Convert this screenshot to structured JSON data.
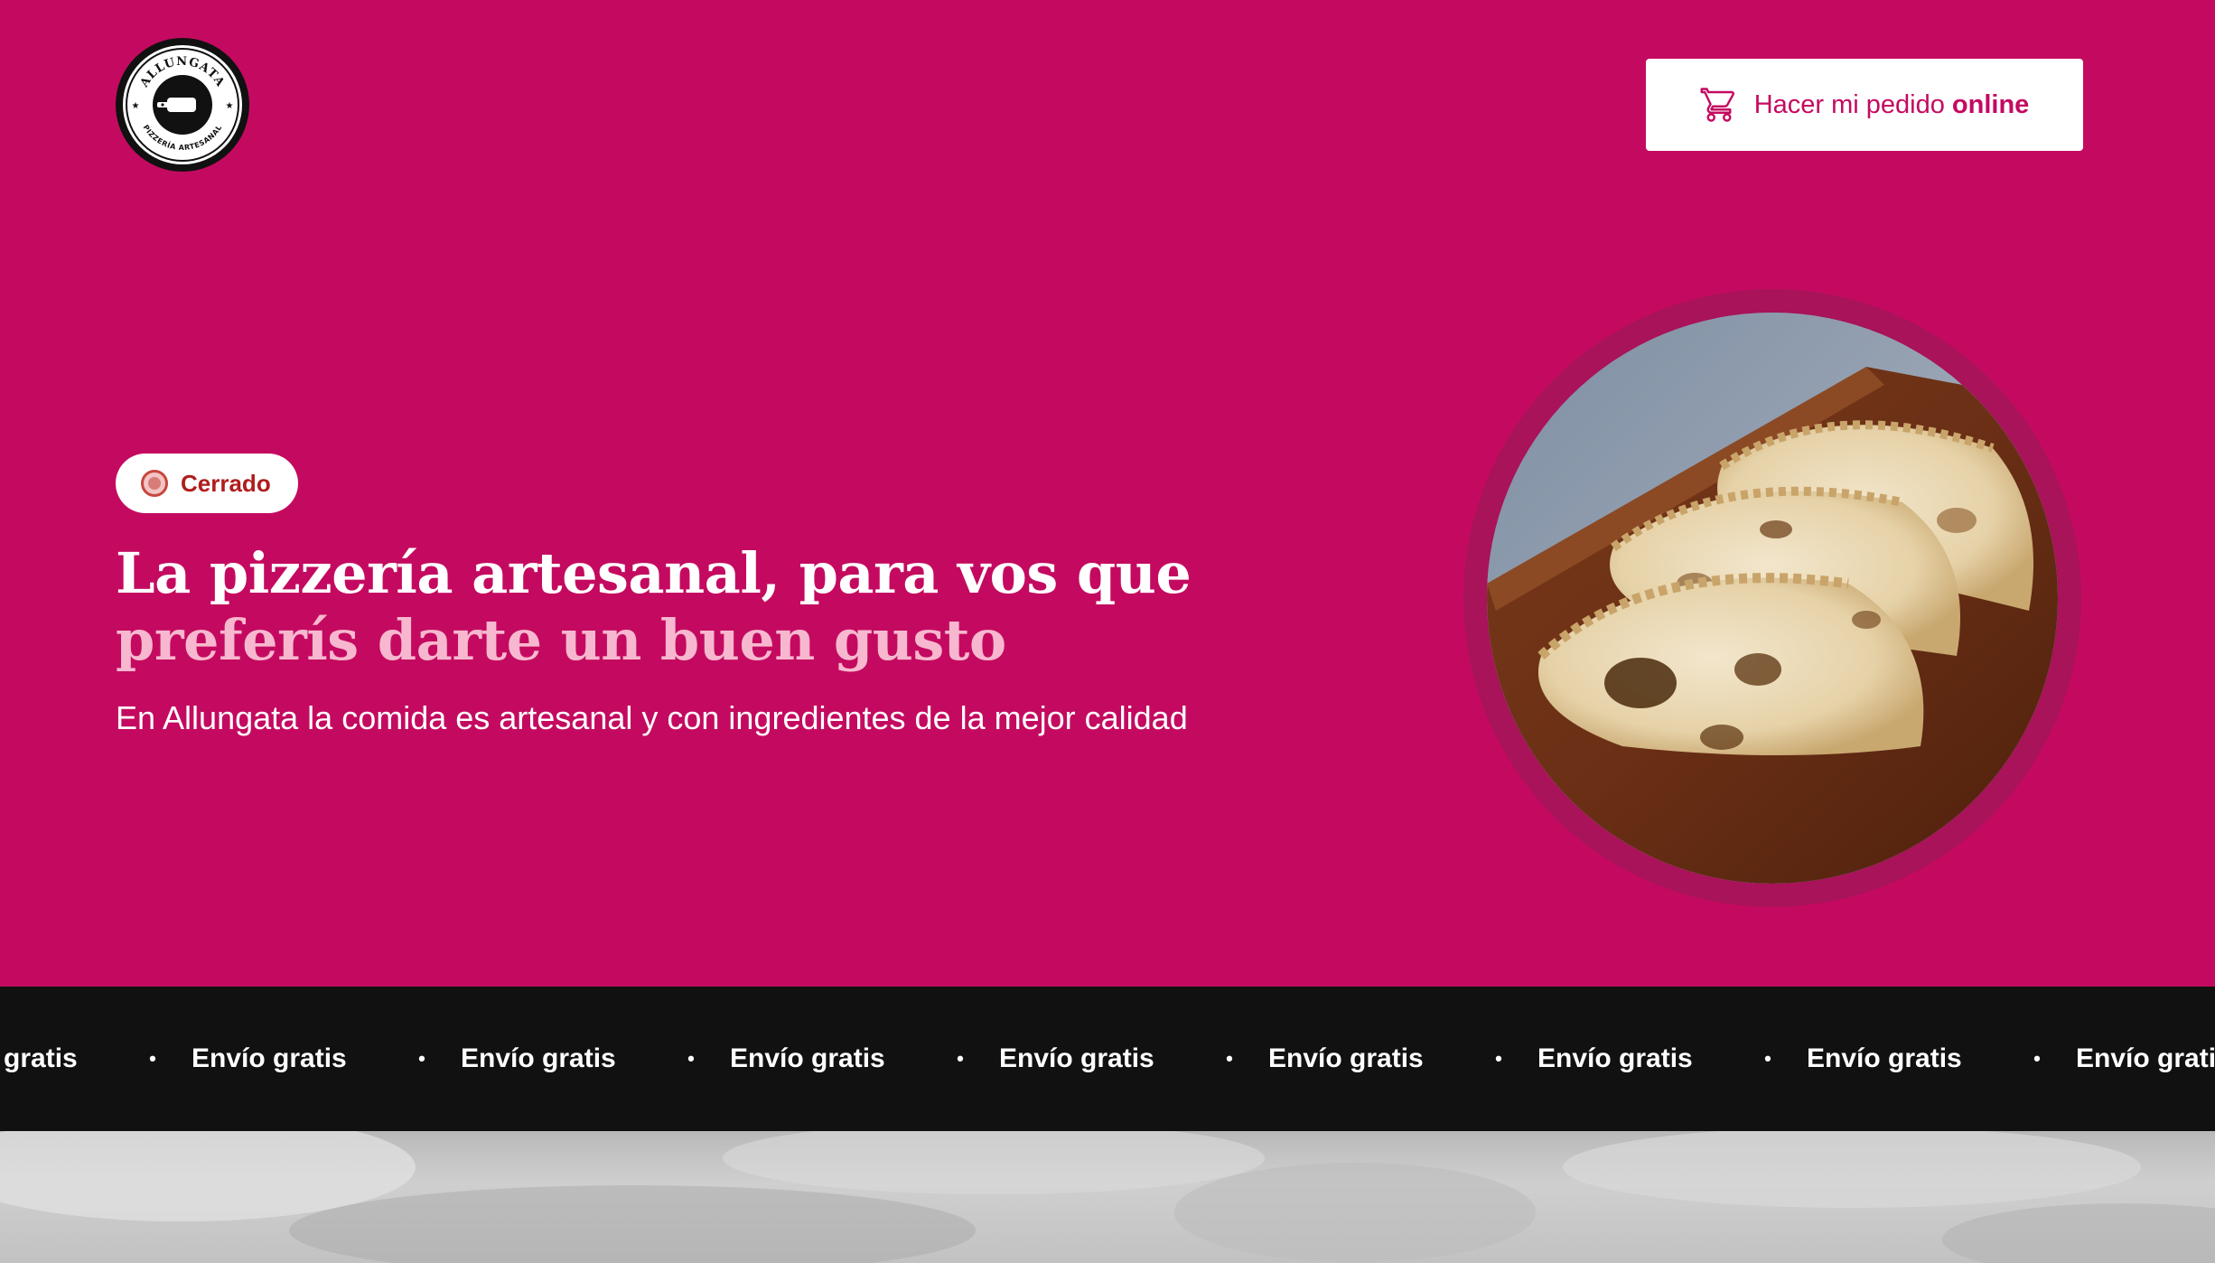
{
  "brand": {
    "logo_top_text": "ALLUNGATA",
    "logo_bottom_text": "PIZZERÍA ARTESANAL",
    "primary_color": "#c40a60",
    "accent_text_color": "#f7b8cf"
  },
  "header": {
    "order_button": {
      "label_prefix": "Hacer mi pedido",
      "label_bold": "online",
      "icon": "cart-icon"
    }
  },
  "hero": {
    "status": {
      "label": "Cerrado",
      "color": "#b01d1d"
    },
    "headline_main": "La pizzería artesanal, para vos que ",
    "headline_accent": "preferís darte un buen gusto",
    "subtitle": "En Allungata la comida es artesanal y con ingredientes de la mejor calidad",
    "image": "empanadas-on-wooden-board"
  },
  "marquee": {
    "item": "Envío gratis",
    "separator": "•",
    "items": [
      "Envío gratis",
      "Envío gratis",
      "Envío gratis",
      "Envío gratis",
      "Envío gratis",
      "Envío gratis",
      "Envío gratis",
      "Envío gratis",
      "Envío gratis"
    ]
  }
}
